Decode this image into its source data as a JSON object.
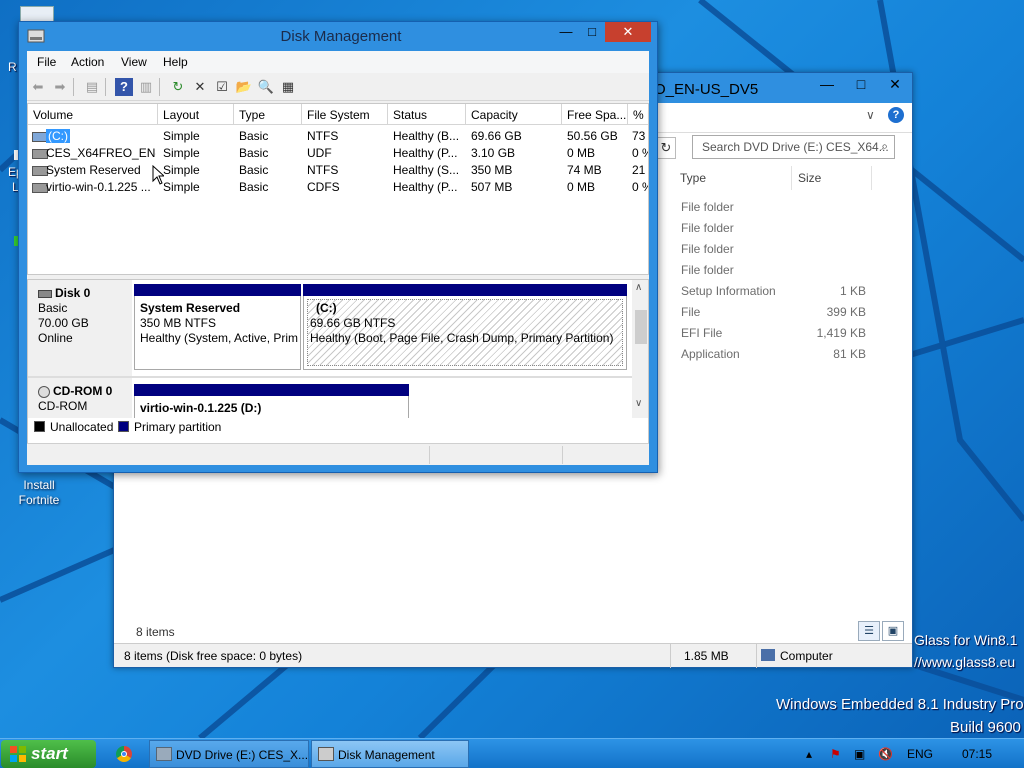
{
  "desktop": {
    "left_labels": [
      "R",
      "Ep",
      "L"
    ],
    "icon_label_line1": "Install",
    "icon_label_line2": "Fortnite",
    "brand_line1": "Glass for Win8.1",
    "brand_line2": "//www.glass8.eu",
    "os_line1": "Windows Embedded 8.1 Industry Pro",
    "os_line2": "Build 9600"
  },
  "explorer": {
    "title": "O_EN-US_DV5",
    "search_placeholder": "Search DVD Drive (E:) CES_X64...",
    "columns": [
      "Type",
      "Size"
    ],
    "rows": [
      {
        "type": "File folder",
        "size": ""
      },
      {
        "type": "File folder",
        "size": ""
      },
      {
        "type": "File folder",
        "size": ""
      },
      {
        "type": "File folder",
        "size": ""
      },
      {
        "type": "Setup Information",
        "size": "1 KB"
      },
      {
        "type": "File",
        "size": "399 KB"
      },
      {
        "type": "EFI File",
        "size": "1,419 KB"
      },
      {
        "type": "Application",
        "size": "81 KB"
      }
    ],
    "item_count": "8 items",
    "status_left": "8 items (Disk free space: 0 bytes)",
    "status_size": "1.85 MB",
    "status_location": "Computer"
  },
  "dm": {
    "title": "Disk Management",
    "menu": [
      "File",
      "Action",
      "View",
      "Help"
    ],
    "columns": [
      "Volume",
      "Layout",
      "Type",
      "File System",
      "Status",
      "Capacity",
      "Free Spa...",
      "% F"
    ],
    "volumes": [
      {
        "volume": "(C:)",
        "layout": "Simple",
        "type": "Basic",
        "fs": "NTFS",
        "status": "Healthy (B...",
        "capacity": "69.66 GB",
        "free": "50.56 GB",
        "pct": "73"
      },
      {
        "volume": "CES_X64FREO_EN-...",
        "layout": "Simple",
        "type": "Basic",
        "fs": "UDF",
        "status": "Healthy (P...",
        "capacity": "3.10 GB",
        "free": "0 MB",
        "pct": "0 %"
      },
      {
        "volume": "System Reserved",
        "layout": "Simple",
        "type": "Basic",
        "fs": "NTFS",
        "status": "Healthy (S...",
        "capacity": "350 MB",
        "free": "74 MB",
        "pct": "21"
      },
      {
        "volume": "virtio-win-0.1.225 ...",
        "layout": "Simple",
        "type": "Basic",
        "fs": "CDFS",
        "status": "Healthy (P...",
        "capacity": "507 MB",
        "free": "0 MB",
        "pct": "0 %"
      }
    ],
    "disk0": {
      "name": "Disk 0",
      "kind": "Basic",
      "size": "70.00 GB",
      "state": "Online",
      "p1": {
        "name": "System Reserved",
        "size": "350 MB NTFS",
        "status": "Healthy (System, Active, Prim"
      },
      "p2": {
        "name": "(C:)",
        "size": "69.66 GB NTFS",
        "status": "Healthy (Boot, Page File, Crash Dump, Primary Partition)"
      }
    },
    "cdrom0": {
      "name": "CD-ROM 0",
      "kind": "CD-ROM",
      "p1": {
        "name": "virtio-win-0.1.225  (D:)"
      }
    },
    "legend": {
      "unallocated": "Unallocated",
      "primary": "Primary partition"
    }
  },
  "taskbar": {
    "start": "start",
    "tasks": [
      "DVD Drive (E:) CES_X...",
      "Disk Management"
    ],
    "lang": "ENG",
    "time": "07:15"
  }
}
